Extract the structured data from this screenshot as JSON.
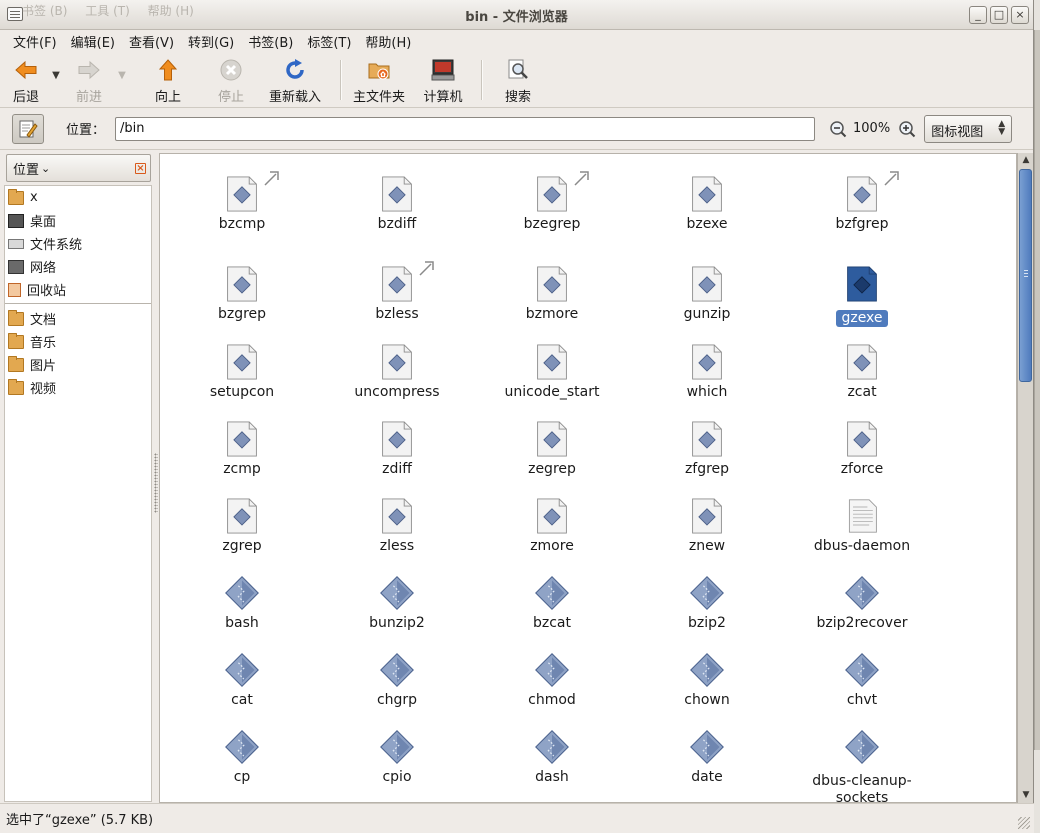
{
  "window": {
    "title": "bin - 文件浏览器",
    "ghost_menu": [
      "书签 (B)",
      "工具 (T)",
      "帮助 (H)"
    ],
    "controls": [
      "_",
      "□",
      "×"
    ]
  },
  "menubar": [
    "文件(F)",
    "编辑(E)",
    "查看(V)",
    "转到(G)",
    "书签(B)",
    "标签(T)",
    "帮助(H)"
  ],
  "toolbar": {
    "back": "后退",
    "forward": "前进",
    "up": "向上",
    "stop": "停止",
    "reload": "重新载入",
    "home": "主文件夹",
    "computer": "计算机",
    "search": "搜索"
  },
  "location": {
    "label": "位置：",
    "path": "/bin",
    "zoom": "100%",
    "view": "图标视图"
  },
  "sidebar": {
    "title": "位置",
    "items": [
      "x",
      "桌面",
      "文件系统",
      "网络",
      "回收站"
    ],
    "bookmarks": [
      "文档",
      "音乐",
      "图片",
      "视频"
    ]
  },
  "files": [
    {
      "name": "bzcmp",
      "kind": "script-link"
    },
    {
      "name": "bzdiff",
      "kind": "script"
    },
    {
      "name": "bzegrep",
      "kind": "script-link"
    },
    {
      "name": "bzexe",
      "kind": "script"
    },
    {
      "name": "bzfgrep",
      "kind": "script-link"
    },
    {
      "name": "bzgrep",
      "kind": "script"
    },
    {
      "name": "bzless",
      "kind": "script-link"
    },
    {
      "name": "bzmore",
      "kind": "script"
    },
    {
      "name": "gunzip",
      "kind": "script"
    },
    {
      "name": "gzexe",
      "kind": "script",
      "selected": true
    },
    {
      "name": "setupcon",
      "kind": "script"
    },
    {
      "name": "uncompress",
      "kind": "script"
    },
    {
      "name": "unicode_start",
      "kind": "script"
    },
    {
      "name": "which",
      "kind": "script"
    },
    {
      "name": "zcat",
      "kind": "script"
    },
    {
      "name": "zcmp",
      "kind": "script"
    },
    {
      "name": "zdiff",
      "kind": "script"
    },
    {
      "name": "zegrep",
      "kind": "script"
    },
    {
      "name": "zfgrep",
      "kind": "script"
    },
    {
      "name": "zforce",
      "kind": "script"
    },
    {
      "name": "zgrep",
      "kind": "script"
    },
    {
      "name": "zless",
      "kind": "script"
    },
    {
      "name": "zmore",
      "kind": "script"
    },
    {
      "name": "znew",
      "kind": "script"
    },
    {
      "name": "dbus-daemon",
      "kind": "text"
    },
    {
      "name": "bash",
      "kind": "exec"
    },
    {
      "name": "bunzip2",
      "kind": "exec"
    },
    {
      "name": "bzcat",
      "kind": "exec"
    },
    {
      "name": "bzip2",
      "kind": "exec"
    },
    {
      "name": "bzip2recover",
      "kind": "exec"
    },
    {
      "name": "cat",
      "kind": "exec"
    },
    {
      "name": "chgrp",
      "kind": "exec"
    },
    {
      "name": "chmod",
      "kind": "exec"
    },
    {
      "name": "chown",
      "kind": "exec"
    },
    {
      "name": "chvt",
      "kind": "exec"
    },
    {
      "name": "cp",
      "kind": "exec"
    },
    {
      "name": "cpio",
      "kind": "exec"
    },
    {
      "name": "dash",
      "kind": "exec"
    },
    {
      "name": "date",
      "kind": "exec"
    },
    {
      "name": "dbus-cleanup-sockets",
      "kind": "exec"
    }
  ],
  "status": "选中了“gzexe” (5.7 KB)",
  "colors": {
    "selection": "#4f7bbd",
    "accent_orange": "#e58a1f",
    "window_bg": "#efebe7"
  }
}
